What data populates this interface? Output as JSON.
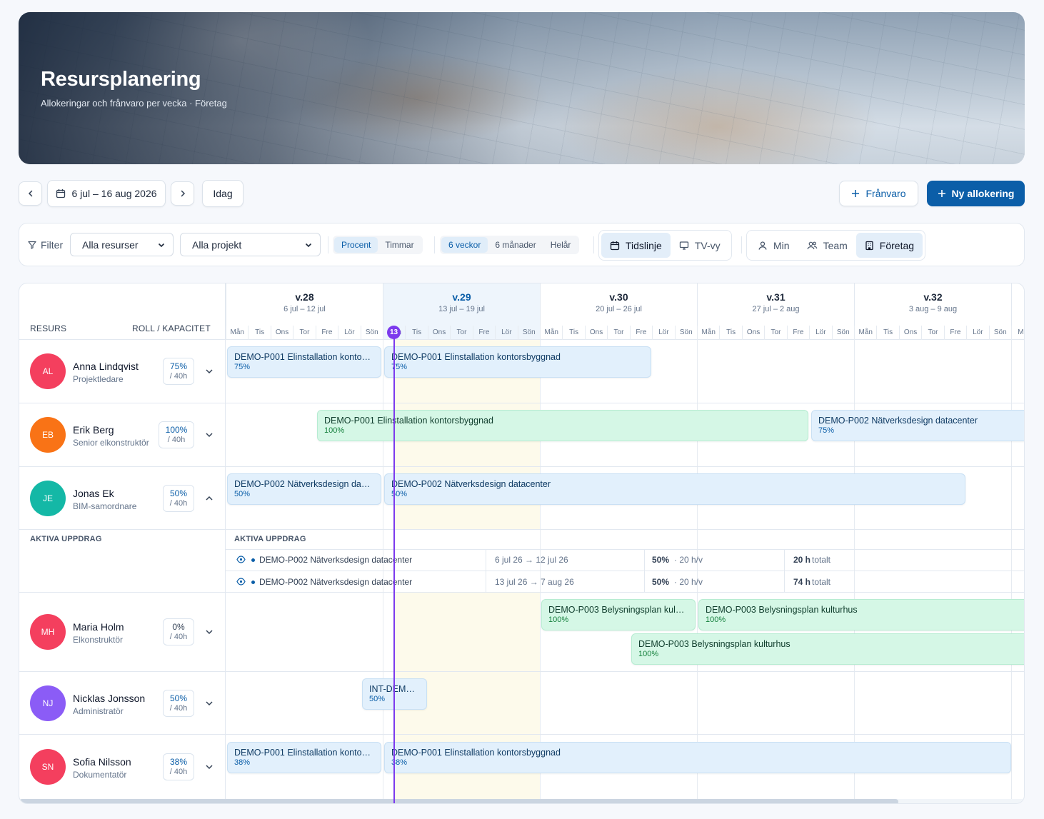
{
  "header": {
    "title": "Resursplanering",
    "subtitle": "Allokeringar och frånvaro per vecka · Företag"
  },
  "nav": {
    "range": "6 jul – 16 aug 2026",
    "today": "Idag",
    "absence": "Frånvaro",
    "new_alloc": "Ny allokering"
  },
  "filters": {
    "label": "Filter",
    "resources": "Alla resurser",
    "projects": "Alla projekt",
    "unit": [
      "Procent",
      "Timmar"
    ],
    "span": [
      "6 veckor",
      "6 månader",
      "Helår"
    ],
    "view": [
      "Tidslinje",
      "TV-vy"
    ],
    "scope": [
      "Min",
      "Team",
      "Företag"
    ]
  },
  "grid": {
    "col_resource": "RESURS",
    "col_role": "ROLL / KAPACITET",
    "today_badge": "13",
    "days": [
      "Mån",
      "Tis",
      "Ons",
      "Tor",
      "Fre",
      "Lör",
      "Sön"
    ],
    "weeks": [
      {
        "w": "v.28",
        "d": "6 jul – 12 jul"
      },
      {
        "w": "v.29",
        "d": "13 jul – 19 jul"
      },
      {
        "w": "v.30",
        "d": "20 jul – 26 jul"
      },
      {
        "w": "v.31",
        "d": "27 jul – 2 aug"
      },
      {
        "w": "v.32",
        "d": "3 aug – 9 aug"
      }
    ],
    "last_day_partial": "Må"
  },
  "resources": [
    {
      "initials": "AL",
      "name": "Anna Lindqvist",
      "role": "Projektledare",
      "pct": "75%",
      "cap": "/ 40h",
      "color": "#f43f5e"
    },
    {
      "initials": "EB",
      "name": "Erik Berg",
      "role": "Senior elkonstruktör",
      "pct": "100%",
      "cap": "/ 40h",
      "color": "#f97316"
    },
    {
      "initials": "JE",
      "name": "Jonas Ek",
      "role": "BIM-samordnare",
      "pct": "50%",
      "cap": "/ 40h",
      "color": "#14b8a6"
    },
    {
      "initials": "MH",
      "name": "Maria Holm",
      "role": "Elkonstruktör",
      "pct": "0%",
      "cap": "/ 40h",
      "color": "#f43f5e"
    },
    {
      "initials": "NJ",
      "name": "Nicklas Jonsson",
      "role": "Administratör",
      "pct": "50%",
      "cap": "/ 40h",
      "color": "#8b5cf6"
    },
    {
      "initials": "SN",
      "name": "Sofia Nilsson",
      "role": "Dokumentatör",
      "pct": "38%",
      "cap": "/ 40h",
      "color": "#f43f5e"
    }
  ],
  "bars": {
    "a1": {
      "t": "DEMO-P001 Elinstallation konto…",
      "p": "75%"
    },
    "a2": {
      "t": "DEMO-P001 Elinstallation kontorsbyggnad",
      "p": "75%"
    },
    "e1": {
      "t": "DEMO-P001 Elinstallation kontorsbyggnad",
      "p": "100%"
    },
    "e2": {
      "t": "DEMO-P002 Nätverksdesign datacenter",
      "p": "75%"
    },
    "j1": {
      "t": "DEMO-P002 Nätverksdesign da…",
      "p": "50%"
    },
    "j2": {
      "t": "DEMO-P002 Nätverksdesign datacenter",
      "p": "50%"
    },
    "m1": {
      "t": "DEMO-P003 Belysningsplan kul…",
      "p": "100%"
    },
    "m2": {
      "t": "DEMO-P003 Belysningsplan kulturhus",
      "p": "100%"
    },
    "m3": {
      "t": "DEMO-P003 Belysningsplan kulturhus",
      "p": "100%"
    },
    "n1": {
      "t": "INT-DEMO…",
      "p": "50%"
    },
    "s1": {
      "t": "DEMO-P001 Elinstallation konto…",
      "p": "38%"
    },
    "s2": {
      "t": "DEMO-P001 Elinstallation kontorsbyggnad",
      "p": "38%"
    }
  },
  "active": {
    "label_left": "AKTIVA UPPDRAG",
    "label": "AKTIVA UPPDRAG",
    "rows": [
      {
        "proj": "DEMO-P002 Nätverksdesign datacenter",
        "dates": "6 jul 26 → 12 jul 26",
        "pct": "50%",
        "hpw": "· 20 h/v",
        "tot": "20 h",
        "tot_l": "totalt"
      },
      {
        "proj": "DEMO-P002 Nätverksdesign datacenter",
        "dates": "13 jul 26 → 7 aug 26",
        "pct": "50%",
        "hpw": "· 20 h/v",
        "tot": "74 h",
        "tot_l": "totalt"
      }
    ]
  }
}
